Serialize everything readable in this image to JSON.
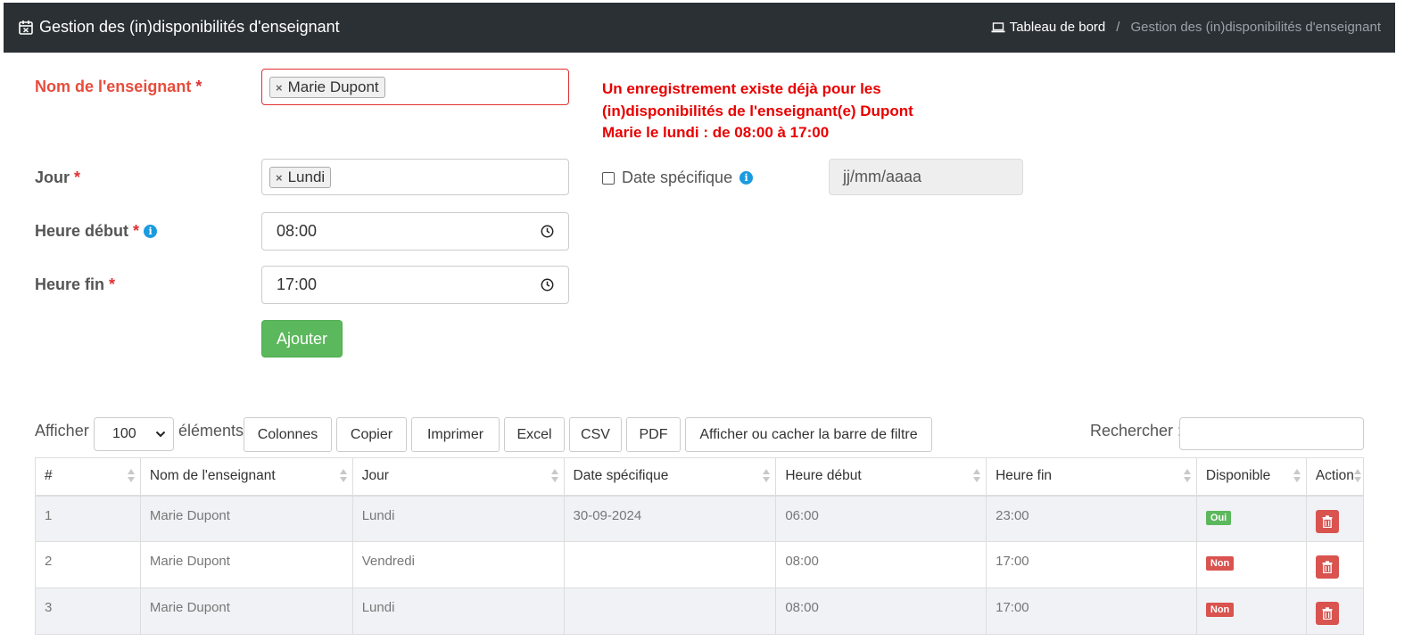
{
  "header": {
    "title": "Gestion des (in)disponibilités d'enseignant",
    "breadcrumb_home": "Tableau de bord",
    "breadcrumb_sep": "/",
    "breadcrumb_current": "Gestion des (in)disponibilités d'enseignant"
  },
  "form": {
    "teacher_label": "Nom de l'enseignant",
    "teacher_value": "Marie Dupont",
    "day_label": "Jour",
    "day_value": "Lundi",
    "start_label": "Heure début",
    "start_value": "08:00",
    "end_label": "Heure fin",
    "end_value": "17:00",
    "required_mark": "*",
    "error_message": "Un enregistrement existe déjà pour les (in)disponibilités de l'enseignant(e) Dupont Marie le lundi : de 08:00 à 17:00",
    "specific_date_label": "Date spécifique",
    "specific_date_placeholder": "jj/mm/aaaa",
    "add_button": "Ajouter",
    "chip_remove": "×"
  },
  "table_controls": {
    "show_label": "Afficher",
    "page_length": "100",
    "elements_label": "éléments",
    "buttons": [
      "Colonnes",
      "Copier",
      "Imprimer",
      "Excel",
      "CSV",
      "PDF",
      "Afficher ou cacher la barre de filtre"
    ],
    "search_label": "Rechercher :"
  },
  "table": {
    "columns": [
      "#",
      "Nom de l'enseignant",
      "Jour",
      "Date spécifique",
      "Heure début",
      "Heure fin",
      "Disponible",
      "Action"
    ],
    "rows": [
      {
        "num": "1",
        "teacher": "Marie Dupont",
        "day": "Lundi",
        "date": "30-09-2024",
        "start": "06:00",
        "end": "23:00",
        "available": "Oui"
      },
      {
        "num": "2",
        "teacher": "Marie Dupont",
        "day": "Vendredi",
        "date": "",
        "start": "08:00",
        "end": "17:00",
        "available": "Non"
      },
      {
        "num": "3",
        "teacher": "Marie Dupont",
        "day": "Lundi",
        "date": "",
        "start": "08:00",
        "end": "17:00",
        "available": "Non"
      }
    ]
  },
  "colors": {
    "header_bg": "#2b3035",
    "error": "#e80000",
    "success": "#5cb85c",
    "danger": "#d9534f",
    "info": "#1a9be0"
  }
}
